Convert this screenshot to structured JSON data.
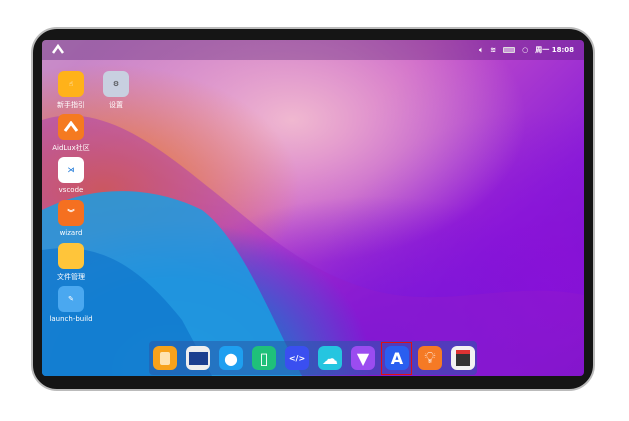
{
  "status_bar": {
    "day": "周一",
    "time": "18:08"
  },
  "desktop_icons": [
    {
      "label": "新手指引",
      "icon": "hand-pointer-icon"
    },
    {
      "label": "设置",
      "icon": "settings-gear-icon"
    },
    {
      "label": "AidLux社区",
      "icon": "aidlux-logo-icon"
    },
    {
      "label": "vscode",
      "icon": "vscode-icon"
    },
    {
      "label": "wizard",
      "icon": "wizard-icon"
    },
    {
      "label": "文件管理",
      "icon": "folder-icon"
    },
    {
      "label": "launch-build",
      "icon": "tools-icon"
    }
  ],
  "dock": [
    {
      "icon": "files-icon",
      "color": "#f7a21b"
    },
    {
      "icon": "terminal-icon",
      "color": "#1b3f8f"
    },
    {
      "icon": "browser-planet-icon",
      "color": "#1e9ff0"
    },
    {
      "icon": "exit-door-icon",
      "color": "#1fc07a"
    },
    {
      "icon": "code-editor-icon",
      "color": "#3a4ff0"
    },
    {
      "icon": "cloud-icon",
      "color": "#25c5e0"
    },
    {
      "icon": "paint-brush-icon",
      "color": "#9b4cf0"
    },
    {
      "icon": "app-store-icon",
      "color": "#2a5ef0",
      "selected": true
    },
    {
      "icon": "lightbulb-icon",
      "color": "#f57a25"
    },
    {
      "icon": "calculator-icon",
      "color": "#f2f2f2"
    }
  ]
}
